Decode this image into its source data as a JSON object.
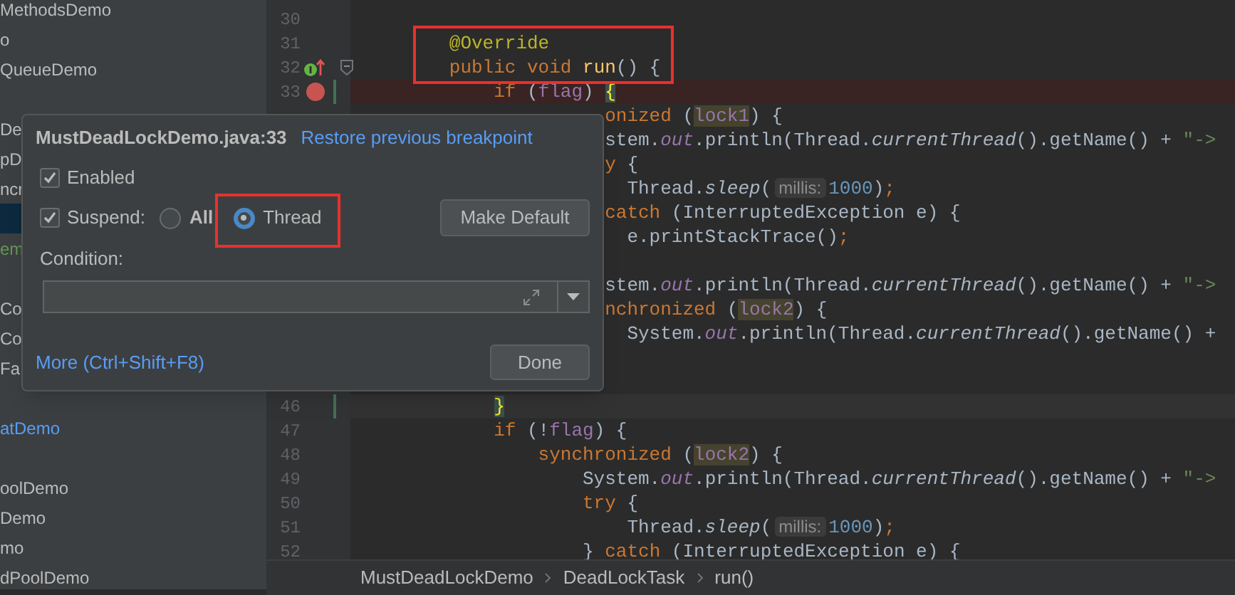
{
  "project_tree": {
    "items": [
      {
        "label": "MethodsDemo",
        "color": "#bbbbbb",
        "selected": false
      },
      {
        "label": "o",
        "color": "#bbbbbb",
        "selected": false
      },
      {
        "label": "QueueDemo",
        "color": "#bbbbbb",
        "selected": false
      },
      {
        "selected": false
      },
      {
        "label": "De",
        "color": "#bbbbbb",
        "selected": false
      },
      {
        "label": "pD",
        "color": "#bbbbbb",
        "selected": false
      },
      {
        "label": "ncr",
        "color": "#bbbbbb",
        "selected": false
      },
      {
        "selected": true
      },
      {
        "label": "em",
        "color": "#629755",
        "selected": false
      },
      {
        "selected": false
      },
      {
        "label": "Co",
        "color": "#bbbbbb",
        "selected": false
      },
      {
        "label": "Co",
        "color": "#bbbbbb",
        "selected": false
      },
      {
        "label": "Fa",
        "color": "#bbbbbb",
        "selected": false
      },
      {
        "selected": false
      },
      {
        "label": "atDemo",
        "color": "#589df6",
        "selected": false
      },
      {
        "selected": false
      },
      {
        "label": "oolDemo",
        "color": "#bbbbbb",
        "selected": false
      },
      {
        "label": "Demo",
        "color": "#bbbbbb",
        "selected": false
      },
      {
        "label": "mo",
        "color": "#bbbbbb",
        "selected": false
      },
      {
        "label": "dPoolDemo",
        "color": "#bbbbbb",
        "selected": false
      }
    ]
  },
  "code": {
    "lines": [
      {
        "number": "30"
      },
      {
        "number": "31",
        "framed": true,
        "tokens": [
          {
            "kind": "annotation",
            "text": "        @Override"
          }
        ]
      },
      {
        "number": "32",
        "framed": true,
        "implemented": true,
        "fold": true,
        "tokens": [
          {
            "kind": "keyword",
            "text": "        public void "
          },
          {
            "kind": "method_decl",
            "text": "run"
          },
          {
            "kind": "plain",
            "text": "() {"
          }
        ]
      },
      {
        "number": "33",
        "breakpoint": true,
        "changed": true,
        "tokens": [
          {
            "kind": "keyword",
            "text": "            if "
          },
          {
            "kind": "plain",
            "text": "("
          },
          {
            "kind": "field",
            "text": "flag"
          },
          {
            "kind": "plain",
            "text": ") "
          },
          {
            "kind": "brace_match",
            "text": "{"
          }
        ]
      },
      {
        "tokens": [
          {
            "kind": "keyword",
            "text": "                      onized "
          },
          {
            "kind": "plain",
            "text": "("
          },
          {
            "kind": "lock",
            "text": "lock1"
          },
          {
            "kind": "plain",
            "text": ") {"
          }
        ]
      },
      {
        "tokens": [
          {
            "kind": "plain",
            "text": "                      stem."
          },
          {
            "kind": "static_field",
            "text": "out"
          },
          {
            "kind": "plain",
            "text": ".println(Thread."
          },
          {
            "kind": "static",
            "text": "currentThread"
          },
          {
            "kind": "plain",
            "text": "().getName() + "
          },
          {
            "kind": "string",
            "text": "\"->"
          }
        ]
      },
      {
        "tokens": [
          {
            "kind": "keyword",
            "text": "                      y"
          },
          {
            "kind": "plain",
            "text": " {"
          }
        ]
      },
      {
        "tokens": [
          {
            "kind": "plain",
            "text": "                        Thread."
          },
          {
            "kind": "static",
            "text": "sleep"
          },
          {
            "kind": "plain",
            "text": "("
          },
          {
            "kind": "hint",
            "text": "millis:"
          },
          {
            "kind": "number",
            "text": "1000"
          },
          {
            "kind": "plain",
            "text": ")"
          },
          {
            "kind": "keyword",
            "text": ";"
          }
        ]
      },
      {
        "tokens": [
          {
            "kind": "keyword",
            "text": "                      catch"
          },
          {
            "kind": "plain",
            "text": " (InterruptedException e) {"
          }
        ]
      },
      {
        "tokens": [
          {
            "kind": "plain",
            "text": "                        e.printStackTrace()"
          },
          {
            "kind": "keyword",
            "text": ";"
          }
        ]
      },
      {
        "kind": "hidden_row"
      },
      {
        "tokens": [
          {
            "kind": "plain",
            "text": "                      stem."
          },
          {
            "kind": "static_field",
            "text": "out"
          },
          {
            "kind": "plain",
            "text": ".println(Thread."
          },
          {
            "kind": "static",
            "text": "currentThread"
          },
          {
            "kind": "plain",
            "text": "().getName() + "
          },
          {
            "kind": "string",
            "text": "\"->"
          }
        ]
      },
      {
        "tokens": [
          {
            "kind": "keyword",
            "text": "                      nchronized "
          },
          {
            "kind": "plain",
            "text": "("
          },
          {
            "kind": "lock",
            "text": "lock2"
          },
          {
            "kind": "plain",
            "text": ") {"
          }
        ]
      },
      {
        "tokens": [
          {
            "kind": "plain",
            "text": "                        System."
          },
          {
            "kind": "static_field",
            "text": "out"
          },
          {
            "kind": "plain",
            "text": ".println(Thread."
          },
          {
            "kind": "static",
            "text": "currentThread"
          },
          {
            "kind": "plain",
            "text": "().getName() +"
          }
        ]
      },
      {
        "kind": "hidden_row"
      },
      {
        "kind": "hidden_row"
      },
      {
        "number": "46",
        "changed": true,
        "current": true,
        "tokens": [
          {
            "kind": "brace_match",
            "text": "            }"
          }
        ]
      },
      {
        "number": "47",
        "tokens": [
          {
            "kind": "keyword",
            "text": "            if "
          },
          {
            "kind": "plain",
            "text": "(!"
          },
          {
            "kind": "field",
            "text": "flag"
          },
          {
            "kind": "plain",
            "text": ") {"
          }
        ]
      },
      {
        "number": "48",
        "tokens": [
          {
            "kind": "keyword",
            "text": "                synchronized "
          },
          {
            "kind": "plain",
            "text": "("
          },
          {
            "kind": "lock",
            "text": "lock2"
          },
          {
            "kind": "plain",
            "text": ") {"
          }
        ]
      },
      {
        "number": "49",
        "tokens": [
          {
            "kind": "plain",
            "text": "                    System."
          },
          {
            "kind": "static_field",
            "text": "out"
          },
          {
            "kind": "plain",
            "text": ".println(Thread."
          },
          {
            "kind": "static",
            "text": "currentThread"
          },
          {
            "kind": "plain",
            "text": "().getName() + "
          },
          {
            "kind": "string",
            "text": "\"->"
          }
        ]
      },
      {
        "number": "50",
        "tokens": [
          {
            "kind": "keyword",
            "text": "                    try"
          },
          {
            "kind": "plain",
            "text": " {"
          }
        ]
      },
      {
        "number": "51",
        "tokens": [
          {
            "kind": "plain",
            "text": "                        Thread."
          },
          {
            "kind": "static",
            "text": "sleep"
          },
          {
            "kind": "plain",
            "text": "("
          },
          {
            "kind": "hint",
            "text": "millis:"
          },
          {
            "kind": "number",
            "text": "1000"
          },
          {
            "kind": "plain",
            "text": ")"
          },
          {
            "kind": "keyword",
            "text": ";"
          }
        ]
      },
      {
        "number": "52",
        "tokens": [
          {
            "kind": "plain",
            "text": "                    } "
          },
          {
            "kind": "keyword",
            "text": "catch"
          },
          {
            "kind": "plain",
            "text": " (InterruptedException e) {"
          }
        ]
      }
    ]
  },
  "popup": {
    "title": "MustDeadLockDemo.java:33",
    "restore_link": "Restore previous breakpoint",
    "enabled": {
      "label": "Enabled",
      "checked": true
    },
    "suspend": {
      "label": "Suspend:",
      "checked": true,
      "options": [
        {
          "label": "All",
          "selected": false
        },
        {
          "label": "Thread",
          "selected": true,
          "framed": true
        }
      ]
    },
    "make_default_button": "Make Default",
    "condition_label": "Condition:",
    "more_link": "More (Ctrl+Shift+F8)",
    "done_button": "Done"
  },
  "breadcrumbs": [
    "MustDeadLockDemo",
    "DeadLockTask",
    "run()"
  ]
}
